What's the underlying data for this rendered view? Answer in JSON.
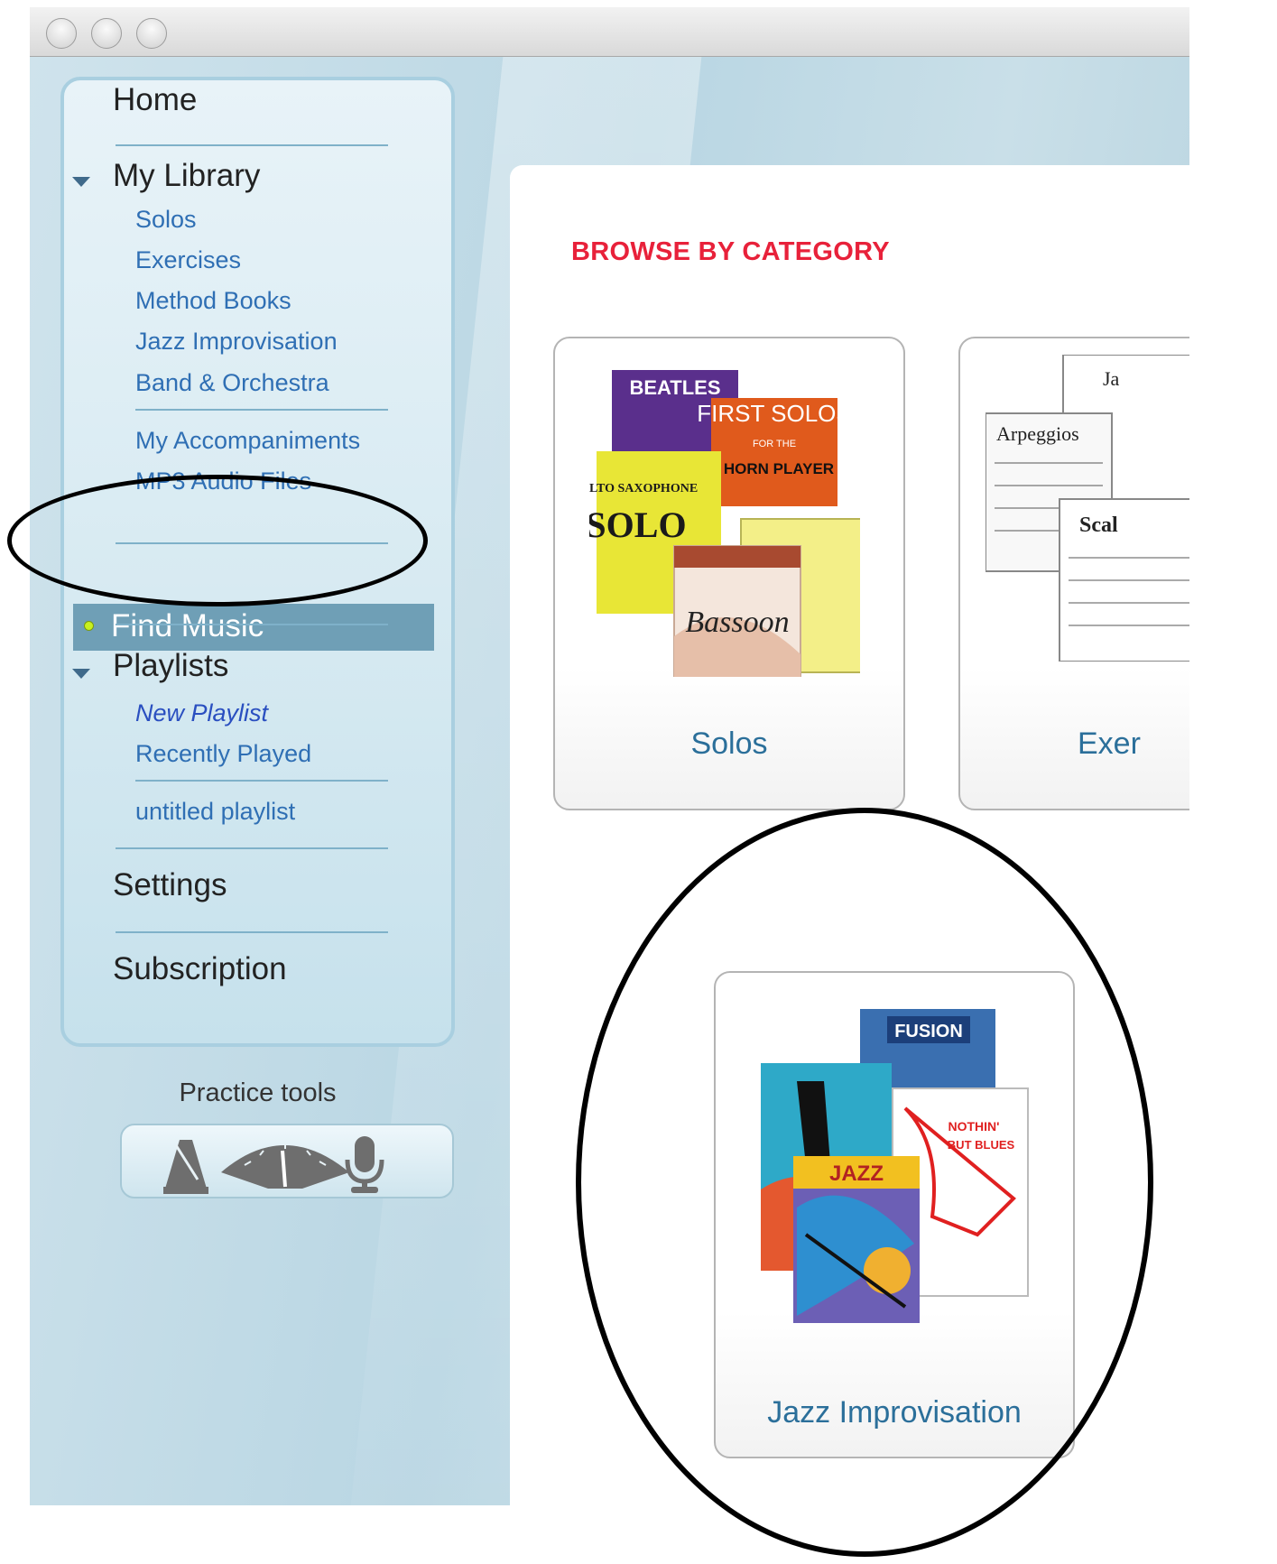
{
  "sidebar": {
    "home": "Home",
    "my_library": {
      "title": "My Library",
      "items": [
        "Solos",
        "Exercises",
        "Method Books",
        "Jazz Improvisation",
        "Band & Orchestra"
      ],
      "extras": [
        "My Accompaniments",
        "MP3 Audio Files"
      ]
    },
    "find_music": "Find Music",
    "playlists": {
      "title": "Playlists",
      "items": [
        "New Playlist",
        "Recently Played"
      ],
      "user_items": [
        "untitled playlist"
      ]
    },
    "settings": "Settings",
    "subscription": "Subscription"
  },
  "practice_tools": {
    "label": "Practice tools",
    "icons": [
      "metronome-icon",
      "tuner-icon",
      "microphone-icon"
    ]
  },
  "main": {
    "browse_title": "BROWSE BY CATEGORY",
    "categories": [
      {
        "label": "Solos",
        "book_titles": [
          "BEATLES",
          "FIRST SOLOS",
          "FOR THE",
          "HORN PLAYER",
          "ALTO SAXOPHONE",
          "SOLO",
          "Bassoon"
        ]
      },
      {
        "label": "Exer",
        "book_titles": [
          "Ja",
          "Arpeggios",
          "Scal"
        ]
      },
      {
        "label": "Jazz Improvisation",
        "book_titles": [
          "FUSION",
          "NOTHIN'",
          "BUT BLUES",
          "JAZZ"
        ]
      }
    ]
  },
  "colors": {
    "accent_red": "#e8213a",
    "link_blue": "#2f6fb4",
    "card_label_blue": "#2b6f9a",
    "selection_bar": "#6f9fb6",
    "sidebar_bg": "#c9dfe8"
  }
}
